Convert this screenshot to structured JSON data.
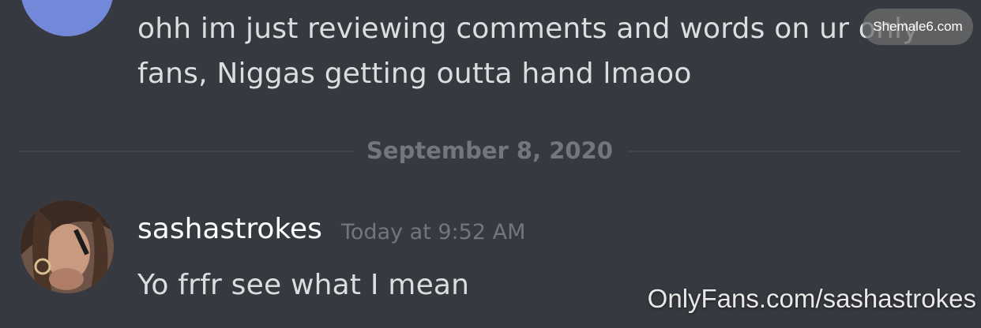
{
  "messages": [
    {
      "text": "ohh im just reviewing comments and words on ur only fans, Niggas getting outta hand lmaoo"
    },
    {
      "username": "sashastrokes",
      "timestamp": "Today at 9:52 AM",
      "text": "Yo frfr see what I mean"
    }
  ],
  "date_divider": "September 8, 2020",
  "watermarks": {
    "top_right": "Shemale6.com",
    "bottom_right": "OnlyFans.com/sashastrokes"
  },
  "colors": {
    "background": "#36393f",
    "message_text": "#dcddde",
    "muted_text": "#72767d",
    "discord_blurple": "#7289da"
  }
}
